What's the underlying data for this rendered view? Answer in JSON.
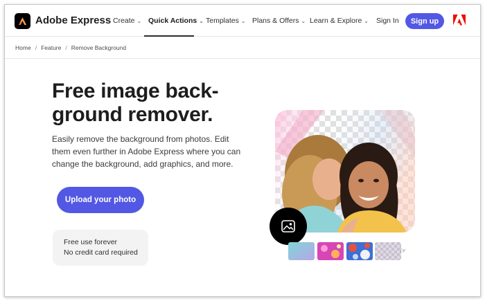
{
  "brand": {
    "name": "Adobe Express",
    "accent": "#5258e4"
  },
  "nav": {
    "items": [
      {
        "label": "Create",
        "active": false
      },
      {
        "label": "Quick Actions",
        "active": true
      },
      {
        "label": "Templates",
        "active": false
      },
      {
        "label": "Plans & Offers",
        "active": false
      },
      {
        "label": "Learn & Explore",
        "active": false
      }
    ],
    "sign_in": "Sign In",
    "sign_up": "Sign up"
  },
  "breadcrumb": [
    "Home",
    "Feature",
    "Remove Background"
  ],
  "hero": {
    "headline_line1": "Free image back-",
    "headline_line2": "ground remover.",
    "subcopy": "Easily remove the background from photos. Edit them even further in Adobe Express where you can change the background, add graphics, and more.",
    "upload_button": "Upload your photo",
    "info_line1": "Free use forever",
    "info_line2": "No credit card required"
  },
  "preview": {
    "image_subject": "two-women-selfie-photo",
    "thumbnails": [
      "teal-gradient-thumb",
      "pink-pattern-thumb",
      "floral-thumb",
      "checkerboard-thumb"
    ]
  }
}
